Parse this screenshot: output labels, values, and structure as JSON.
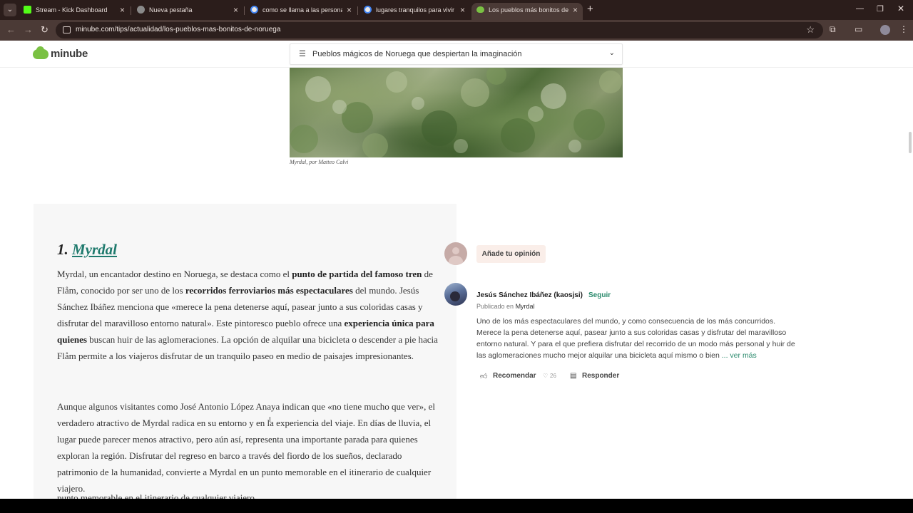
{
  "browser": {
    "tabs": [
      {
        "label": "Stream - Kick Dashboard",
        "favicon_color": "#53fc18",
        "active": false
      },
      {
        "label": "Nueva pestaña",
        "favicon_color": "#8a8a8a",
        "active": false
      },
      {
        "label": "como se llama a las personas q",
        "favicon_color": "#4285f4",
        "active": false
      },
      {
        "label": "lugares tranquilos para vivir en",
        "favicon_color": "#4285f4",
        "active": false
      },
      {
        "label": "Los pueblos más bonitos de No",
        "favicon_color": "#7ac143",
        "active": true
      }
    ],
    "new_tab_glyph": "+",
    "url": "minube.com/tips/actualidad/los-pueblos-mas-bonitos-de-noruega"
  },
  "site": {
    "logo_text": "minube",
    "brand_color": "#7ac143",
    "toc_title": "Pueblos mágicos de Noruega que despiertan la imaginación"
  },
  "photo": {
    "caption": "Myrdal, por Matteo Calvi"
  },
  "article": {
    "heading_number": "1.",
    "heading_link": "Myrdal",
    "p1": [
      {
        "t": "Myrdal, un encantador destino en Noruega, se destaca como el "
      },
      {
        "t": "punto de partida del famoso tren",
        "b": true
      },
      {
        "t": " de Flåm, conocido por ser uno de los "
      },
      {
        "t": "recorridos ferroviarios más espectaculares",
        "b": true
      },
      {
        "t": " del mundo. Jesús Sánchez Ibáñez menciona que «merece la pena detenerse aquí, pasear junto a sus coloridas casas y disfrutar del maravilloso entorno natural». Este pintoresco pueblo ofrece una "
      },
      {
        "t": "experiencia única para quienes",
        "b": true
      },
      {
        "t": " buscan huir de las aglomeraciones. La opción de alquilar una bicicleta o descender a pie hacia Flåm permite a los viajeros disfrutar de un tranquilo paseo en medio de paisajes impresionantes."
      }
    ],
    "p2": "Aunque algunos visitantes como José Antonio López Anaya indican que «no tiene mucho que ver», el verdadero atractivo de Myrdal radica en su entorno y en la experiencia del viaje. En días de lluvia, el lugar puede parecer menos atractivo, pero aún así, representa una importante parada para quienes exploran la región. Disfrutar del regreso en barco a través del fiordo de los sueños, declarado patrimonio de la humanidad, convierte a Myrdal en un punto memorable en el itinerario de cualquier viajero.",
    "p3_overflow": "punto memorable en el itinerario de cualquier viajero."
  },
  "opinion": {
    "button_label": "Añade tu opinión"
  },
  "comment": {
    "author": "Jesús Sánchez Ibáñez (kaosjsi)",
    "follow_label": "Seguir",
    "published_prefix": "Publicado en",
    "published_place": "Myrdal",
    "text": "Uno de los más espectaculares del mundo, y como consecuencia de los más concurridos. Merece la pena detenerse aquí, pasear junto a sus coloridas casas y disfrutar del maravilloso entorno natural. Y para el que prefiera disfrutar del recorrido de un modo más personal y huir de las aglomeraciones mucho mejor alquilar una bicicleta aquí mismo o bien",
    "more_label": "... ver más",
    "recommend_label": "Recomendar",
    "like_count": "26",
    "reply_label": "Responder",
    "link_color": "#2a8a6c"
  }
}
